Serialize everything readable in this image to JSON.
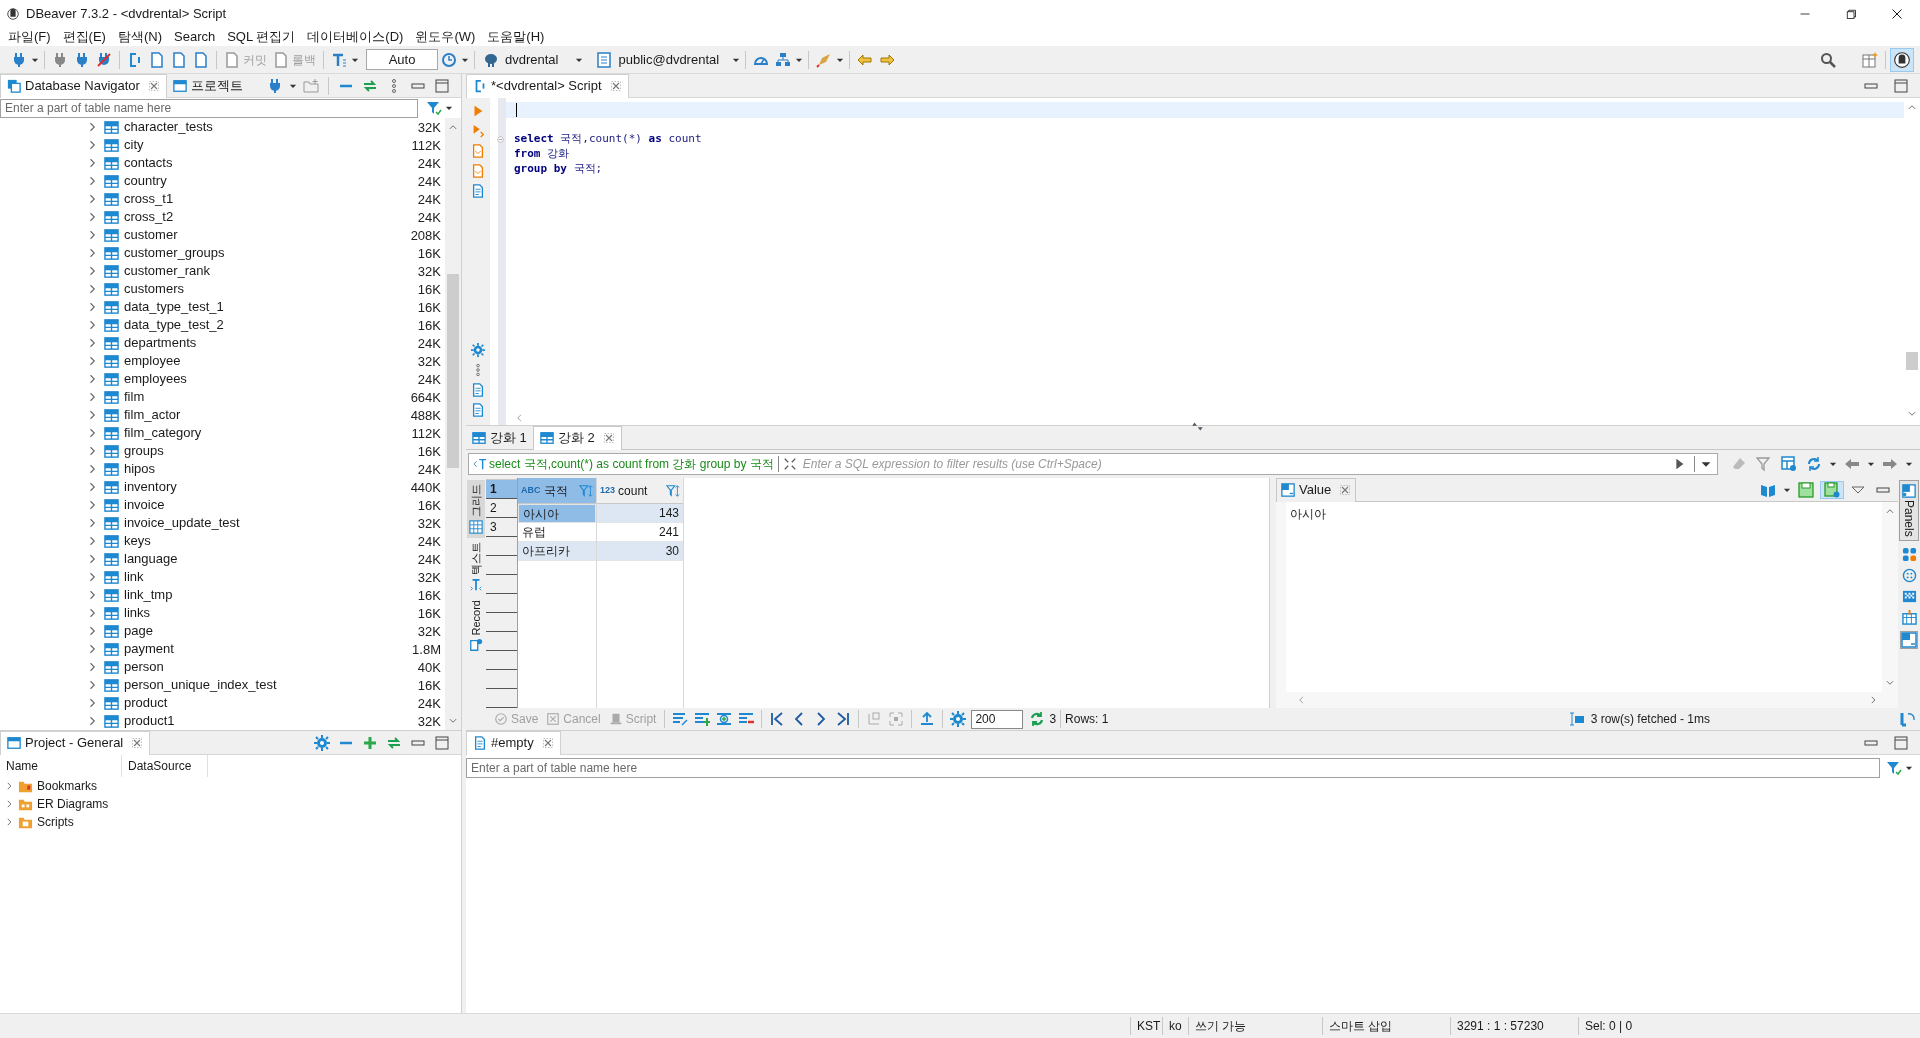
{
  "window": {
    "title": "DBeaver 7.3.2 - <dvdrental> Script"
  },
  "menu": [
    "파일(F)",
    "편집(E)",
    "탐색(N)",
    "Search",
    "SQL 편집기",
    "데이터베이스(D)",
    "윈도우(W)",
    "도움말(H)"
  ],
  "toolbar": {
    "commit": {
      "label": "커밋",
      "disabled": true
    },
    "rollback": {
      "label": "롤백",
      "disabled": true
    },
    "mode": "Auto",
    "connection": "dvdrental",
    "schema": "public@dvdrental"
  },
  "navigator": {
    "tabs": [
      {
        "label": "Database Navigator",
        "selected": true
      },
      {
        "label": "프로젝트",
        "selected": false
      }
    ],
    "placeholder": "Enter a part of table name here",
    "tables": [
      {
        "name": "character_tests",
        "size": "32K"
      },
      {
        "name": "city",
        "size": "112K"
      },
      {
        "name": "contacts",
        "size": "24K"
      },
      {
        "name": "country",
        "size": "24K"
      },
      {
        "name": "cross_t1",
        "size": "24K"
      },
      {
        "name": "cross_t2",
        "size": "24K"
      },
      {
        "name": "customer",
        "size": "208K"
      },
      {
        "name": "customer_groups",
        "size": "16K"
      },
      {
        "name": "customer_rank",
        "size": "32K"
      },
      {
        "name": "customers",
        "size": "16K"
      },
      {
        "name": "data_type_test_1",
        "size": "16K"
      },
      {
        "name": "data_type_test_2",
        "size": "16K"
      },
      {
        "name": "departments",
        "size": "24K"
      },
      {
        "name": "employee",
        "size": "32K"
      },
      {
        "name": "employees",
        "size": "24K"
      },
      {
        "name": "film",
        "size": "664K"
      },
      {
        "name": "film_actor",
        "size": "488K"
      },
      {
        "name": "film_category",
        "size": "112K"
      },
      {
        "name": "groups",
        "size": "16K"
      },
      {
        "name": "hipos",
        "size": "24K"
      },
      {
        "name": "inventory",
        "size": "440K"
      },
      {
        "name": "invoice",
        "size": "16K"
      },
      {
        "name": "invoice_update_test",
        "size": "32K"
      },
      {
        "name": "keys",
        "size": "24K"
      },
      {
        "name": "language",
        "size": "24K"
      },
      {
        "name": "link",
        "size": "32K"
      },
      {
        "name": "link_tmp",
        "size": "16K"
      },
      {
        "name": "links",
        "size": "16K"
      },
      {
        "name": "page",
        "size": "32K"
      },
      {
        "name": "payment",
        "size": "1.8M"
      },
      {
        "name": "person",
        "size": "40K"
      },
      {
        "name": "person_unique_index_test",
        "size": "16K"
      },
      {
        "name": "product",
        "size": "24K"
      },
      {
        "name": "product1",
        "size": "32K"
      }
    ]
  },
  "editor": {
    "tab": "*<dvdrental> Script",
    "lines": [
      [
        {
          "text": "select",
          "kind": "keyword"
        },
        {
          "text": " 국적,count(*) ",
          "kind": "plain"
        },
        {
          "text": "as",
          "kind": "keyword"
        },
        {
          "text": " count",
          "kind": "plain"
        }
      ],
      [
        {
          "text": "from",
          "kind": "keyword"
        },
        {
          "text": " 강화",
          "kind": "plain"
        }
      ],
      [
        {
          "text": "group by",
          "kind": "keyword"
        },
        {
          "text": " 국적;",
          "kind": "plain"
        }
      ]
    ]
  },
  "results": {
    "tabs": [
      {
        "label": "강화 1",
        "selected": false
      },
      {
        "label": "강화 2",
        "selected": true
      }
    ],
    "query": "select 국적,count(*) as count from 강화 group by 국적",
    "filter_placeholder": "Enter a SQL expression to filter results (use Ctrl+Space)",
    "view_tabs": [
      {
        "label": "그리드",
        "selected": true
      },
      {
        "label": "텍스트",
        "selected": false
      },
      {
        "label": "Record",
        "selected": false
      }
    ],
    "columns": [
      {
        "name": "국적",
        "type": "ABC"
      },
      {
        "name": "count",
        "type": "123"
      }
    ],
    "rows": [
      {
        "num": "1",
        "cells": [
          "아시아",
          "143"
        ],
        "selected": true
      },
      {
        "num": "2",
        "cells": [
          "유럽",
          "241"
        ],
        "selected": false
      },
      {
        "num": "3",
        "cells": [
          "아프리카",
          "30"
        ],
        "selected": false
      }
    ],
    "actions": [
      {
        "label": "Save",
        "disabled": true
      },
      {
        "label": "Cancel",
        "disabled": true
      },
      {
        "label": "Script",
        "disabled": true
      }
    ],
    "fetch_size": "200",
    "fetched_count": "3",
    "rows_label": "Rows: 1",
    "value_panel": {
      "title": "Value",
      "content": "아시아"
    },
    "status": "3 row(s) fetched - 1ms",
    "panels_label": "Panels"
  },
  "project": {
    "title": "Project - General",
    "columns": [
      "Name",
      "DataSource"
    ],
    "items": [
      "Bookmarks",
      "ER Diagrams",
      "Scripts"
    ]
  },
  "empty_panel": {
    "tab": "#empty",
    "placeholder": "Enter a part of table name here"
  },
  "status_bar": [
    "KST",
    "ko",
    "쓰기 가능",
    "스마트 삽입",
    "3291 : 1 : 57230",
    "Sel: 0 | 0"
  ]
}
